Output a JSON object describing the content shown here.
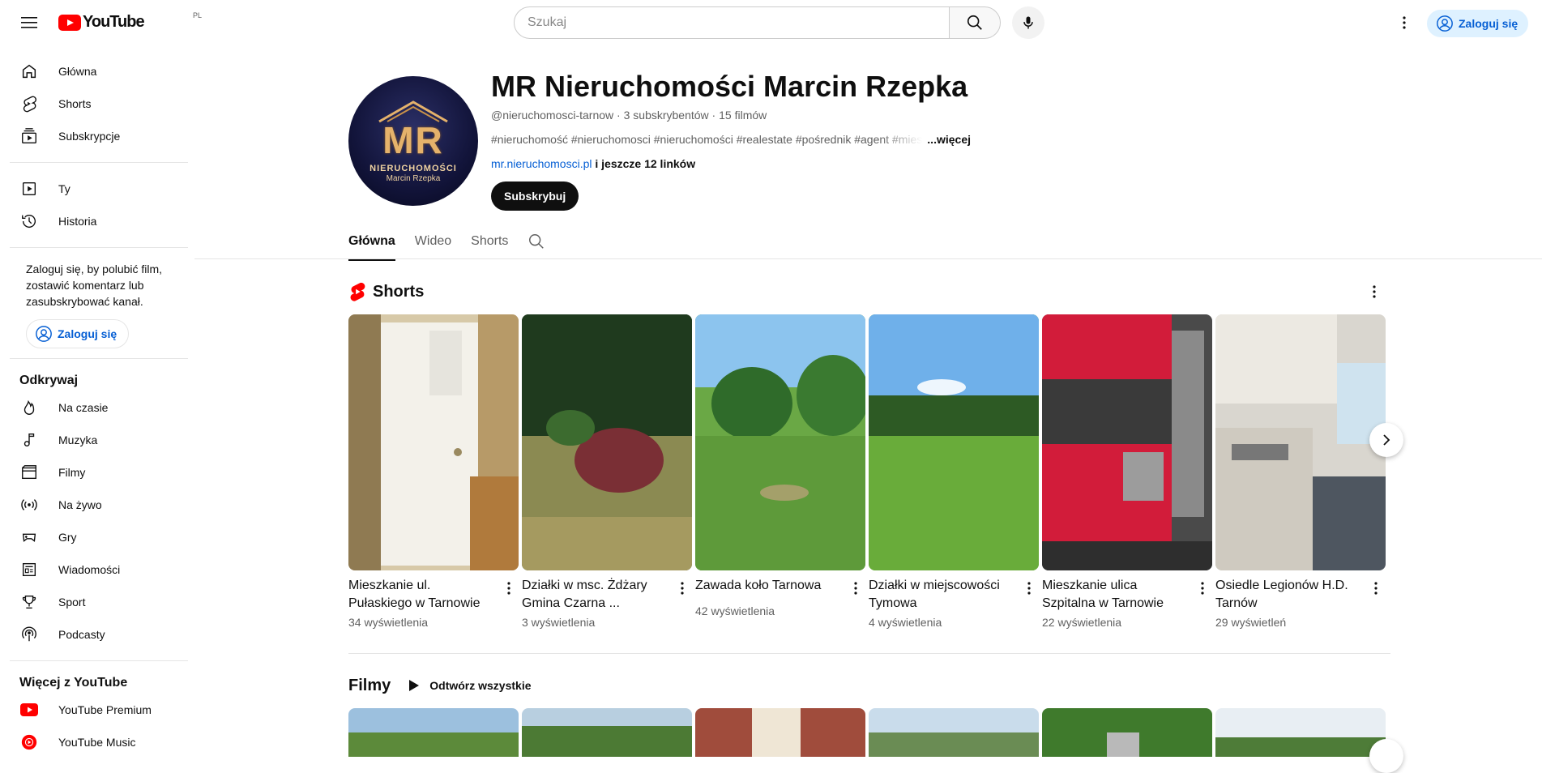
{
  "masthead": {
    "logo_text": "YouTube",
    "country_code": "PL",
    "search_placeholder": "Szukaj",
    "signin_label": "Zaloguj się"
  },
  "sidebar": {
    "main_items": [
      {
        "label": "Główna",
        "icon": "home-icon"
      },
      {
        "label": "Shorts",
        "icon": "shorts-icon"
      },
      {
        "label": "Subskrypcje",
        "icon": "subscriptions-icon"
      }
    ],
    "you_items": [
      {
        "label": "Ty",
        "icon": "you-icon"
      },
      {
        "label": "Historia",
        "icon": "history-icon"
      }
    ],
    "signin_promo": "Zaloguj się, by polubić film, zostawić komentarz lub zasubskrybować kanał.",
    "signin_label": "Zaloguj się",
    "explore_title": "Odkrywaj",
    "explore_items": [
      {
        "label": "Na czasie",
        "icon": "trending-icon"
      },
      {
        "label": "Muzyka",
        "icon": "music-icon"
      },
      {
        "label": "Filmy",
        "icon": "movies-icon"
      },
      {
        "label": "Na żywo",
        "icon": "live-icon"
      },
      {
        "label": "Gry",
        "icon": "gaming-icon"
      },
      {
        "label": "Wiadomości",
        "icon": "news-icon"
      },
      {
        "label": "Sport",
        "icon": "sport-icon"
      },
      {
        "label": "Podcasty",
        "icon": "podcasts-icon"
      }
    ],
    "more_title": "Więcej z YouTube",
    "more_items": [
      {
        "label": "YouTube Premium",
        "icon": "youtube-premium-icon"
      },
      {
        "label": "YouTube Music",
        "icon": "youtube-music-icon"
      }
    ]
  },
  "channel": {
    "avatar_text_main": "MR",
    "avatar_text_sub": "NIERUCHOMOŚCI",
    "avatar_text_name": "Marcin Rzepka",
    "title": "MR Nieruchomości Marcin Rzepka",
    "handle": "@nieruchomosci-tarnow",
    "subscribers": "3 subskrybentów",
    "videos": "15 filmów",
    "description": "#nieruchomość #nieruchomosci #nieruchomości #realestate #pośrednik #agent #mies",
    "more_label": "...więcej",
    "link": "mr.nieruchomosci.pl",
    "link_rest": "i jeszcze 12 linków",
    "subscribe_label": "Subskrybuj"
  },
  "tabs": [
    "Główna",
    "Wideo",
    "Shorts"
  ],
  "shorts_shelf": {
    "title": "Shorts",
    "items": [
      {
        "title": "Mieszkanie ul. Pułaskiego w Tarnowie",
        "views": "34 wyświetlenia"
      },
      {
        "title": "Działki w msc. Żdżary Gmina Czarna ...",
        "views": "3 wyświetlenia"
      },
      {
        "title": "Zawada koło Tarnowa",
        "views": "42 wyświetlenia"
      },
      {
        "title": "Działki w miejscowości Tymowa",
        "views": "4 wyświetlenia"
      },
      {
        "title": "Mieszkanie ulica Szpitalna w Tarnowie",
        "views": "22 wyświetlenia"
      },
      {
        "title": "Osiedle Legionów H.D. Tarnów",
        "views": "29 wyświetleń"
      }
    ]
  },
  "films_shelf": {
    "title": "Filmy",
    "play_all_label": "Odtwórz wszystkie"
  },
  "colors": {
    "accent": "#065fd4",
    "brand_red": "#ff0000",
    "signin_bg": "#def1ff"
  }
}
